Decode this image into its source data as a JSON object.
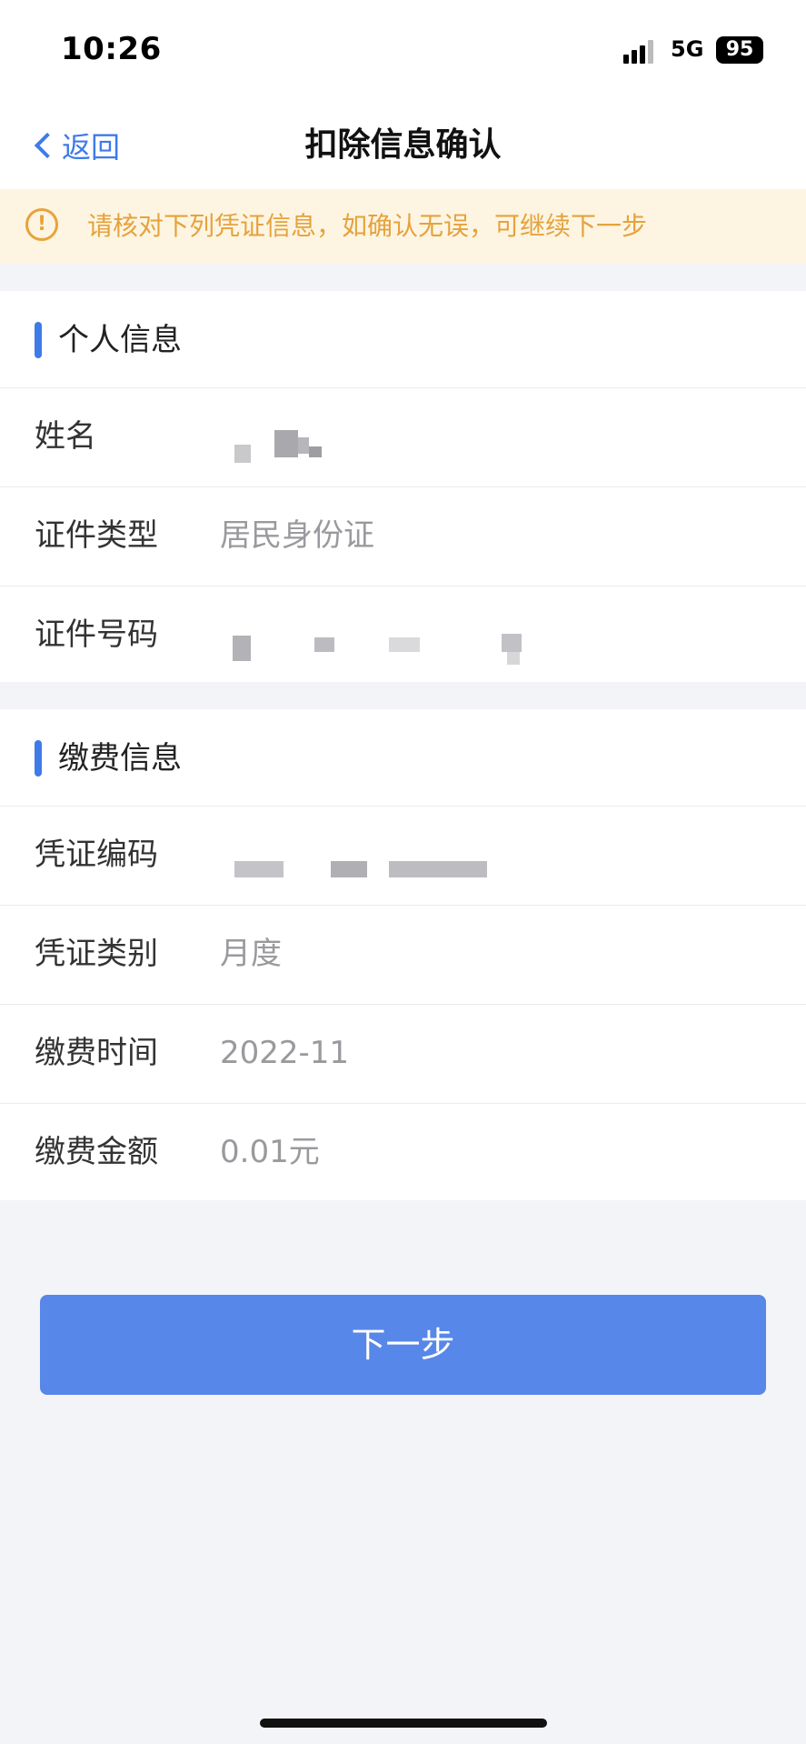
{
  "status_bar": {
    "time": "10:26",
    "network": "5G",
    "battery": "95"
  },
  "nav": {
    "back_label": "返回",
    "title": "扣除信息确认"
  },
  "notice": {
    "text": "请核对下列凭证信息，如确认无误，可继续下一步"
  },
  "personal_info": {
    "title": "个人信息",
    "rows": [
      {
        "label": "姓名",
        "value": ""
      },
      {
        "label": "证件类型",
        "value": "居民身份证"
      },
      {
        "label": "证件号码",
        "value": ""
      }
    ]
  },
  "payment_info": {
    "title": "缴费信息",
    "rows": [
      {
        "label": "凭证编码",
        "value": ""
      },
      {
        "label": "凭证类别",
        "value": "月度"
      },
      {
        "label": "缴费时间",
        "value": "2022-11"
      },
      {
        "label": "缴费金额",
        "value": "0.01元"
      }
    ]
  },
  "next_button": {
    "label": "下一步"
  },
  "colors": {
    "accent": "#3f7be8",
    "button": "#5787e8",
    "notice_text": "#e6a23c",
    "notice_bg": "#fdf5e2"
  }
}
